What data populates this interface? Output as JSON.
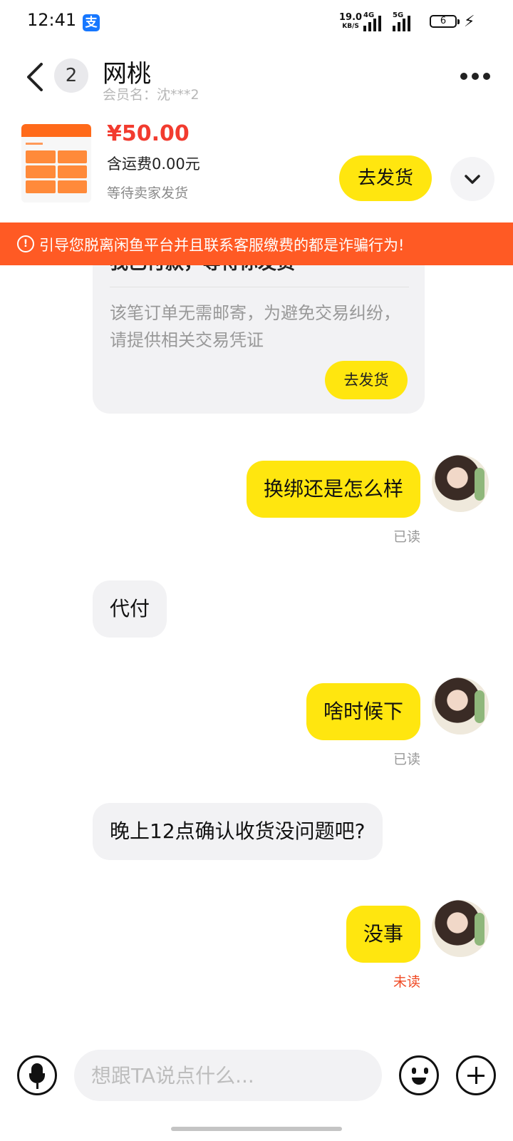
{
  "status_bar": {
    "time": "12:41",
    "app_icon": "支",
    "net_speed": "19.0",
    "net_unit": "KB/S",
    "sim1": "4G",
    "sim2": "5G",
    "battery": "6"
  },
  "header": {
    "unread_count": "2",
    "name": "网桃",
    "member_name": "会员名：沈***2"
  },
  "product": {
    "price": "¥50.00",
    "shipping": "含运费0.00元",
    "status": "等待卖家发货",
    "ship_button": "去发货"
  },
  "warning": {
    "text": "引导您脱离闲鱼平台并且联系客服缴费的都是诈骗行为!"
  },
  "system_card": {
    "title": "我已付款，等待你发货",
    "description": "该笔订单无需邮寄，为避免交易纠纷，请提供相关交易凭证",
    "button": "去发货"
  },
  "messages": [
    {
      "direction": "out",
      "text": "换绑还是怎么样",
      "status": "已读"
    },
    {
      "direction": "in",
      "text": "代付"
    },
    {
      "direction": "out",
      "text": "啥时候下",
      "status": "已读"
    },
    {
      "direction": "in",
      "text": "晚上12点确认收货没问题吧?"
    },
    {
      "direction": "out",
      "text": "没事",
      "status": "未读"
    }
  ],
  "input": {
    "placeholder": "想跟TA说点什么..."
  },
  "icons": {
    "back": "back-arrow-icon",
    "more": "more-dots-icon",
    "expand": "chevron-down-icon",
    "warning": "alert-circle-icon",
    "voice": "microphone-icon",
    "emoji": "emoji-icon",
    "plus": "plus-icon"
  },
  "colors": {
    "accent_yellow": "#ffe60f",
    "warning_orange": "#ff5a24",
    "price_red": "#f23b2f",
    "unread_red": "#f04a24"
  }
}
